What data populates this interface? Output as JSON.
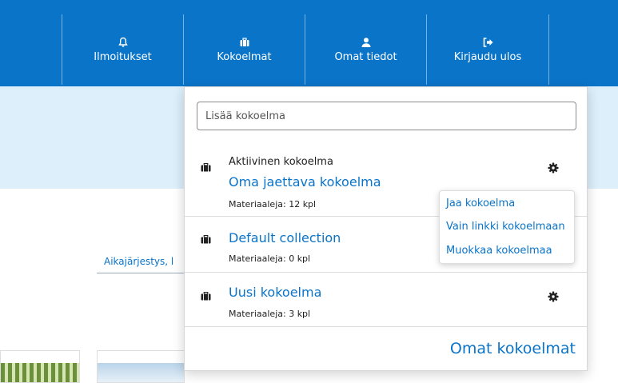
{
  "nav": {
    "items": [
      {
        "label": "Ilmoitukset",
        "icon": "bell-icon"
      },
      {
        "label": "Kokoelmat",
        "icon": "briefcase-icon"
      },
      {
        "label": "Omat tiedot",
        "icon": "user-icon"
      },
      {
        "label": "Kirjaudu ulos",
        "icon": "sign-out-icon"
      }
    ]
  },
  "background": {
    "sort_label": "Aikajärjestys, l"
  },
  "dropdown": {
    "search_placeholder": "Lisää kokoelma",
    "collections": [
      {
        "active_label": "Aktiivinen kokoelma",
        "title": "Oma jaettava kokoelma",
        "count": "Materiaaleja: 12 kpl"
      },
      {
        "title": "Default collection",
        "count": "Materiaaleja: 0 kpl"
      },
      {
        "title": "Uusi kokoelma",
        "count": "Materiaaleja: 3 kpl"
      }
    ],
    "footer_link": "Omat kokoelmat"
  },
  "popup_menu": {
    "items": [
      "Jaa kokoelma",
      "Vain linkki kokoelmaan",
      "Muokkaa kokoelmaa"
    ]
  },
  "colors": {
    "brand_blue": "#0a74c9",
    "band_blue": "#dceffb"
  }
}
